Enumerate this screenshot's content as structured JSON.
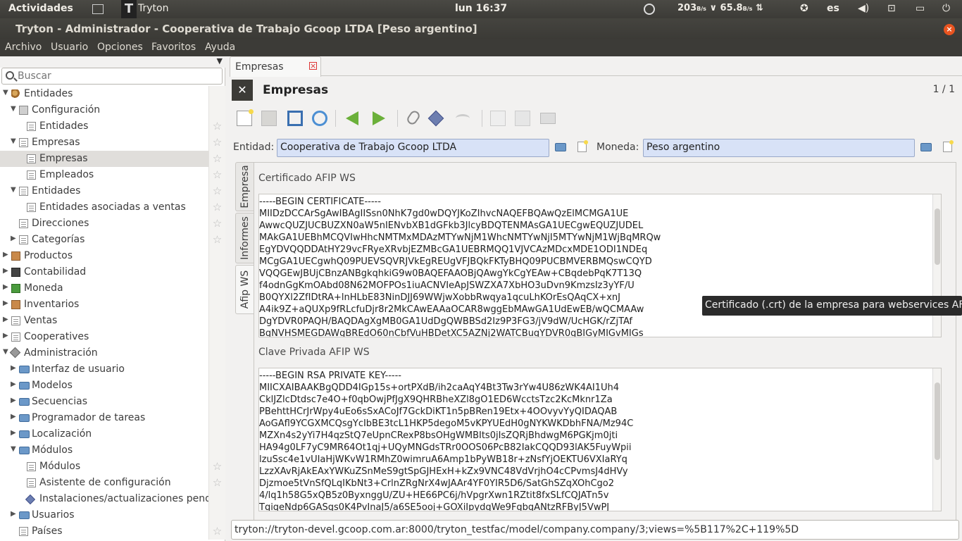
{
  "top_panel": {
    "activities": "Actividades",
    "app_name": "Tryton",
    "clock": "lun 16:37",
    "net_down": "203",
    "net_down_unit": "B/s",
    "net_up": "65.8",
    "net_up_unit": "B/s",
    "lang": "es"
  },
  "window": {
    "title": "Tryton - Administrador - Cooperativa de Trabajo Gcoop LTDA [Peso argentino]",
    "close": "×"
  },
  "menubar": {
    "items": [
      "Archivo",
      "Usuario",
      "Opciones",
      "Favoritos",
      "Ayuda"
    ]
  },
  "sidebar": {
    "search_placeholder": "Buscar",
    "tree": [
      {
        "label": "Entidades",
        "level": 0,
        "expander": "▼",
        "icon": "people",
        "star": false
      },
      {
        "label": "Configuración",
        "level": 1,
        "expander": "▼",
        "icon": "config",
        "star": false
      },
      {
        "label": "Entidades",
        "level": 2,
        "expander": "",
        "icon": "doc",
        "star": true
      },
      {
        "label": "Empresas",
        "level": 1,
        "expander": "▼",
        "icon": "doc",
        "star": true
      },
      {
        "label": "Empresas",
        "level": 2,
        "expander": "",
        "icon": "doc",
        "star": true,
        "selected": true
      },
      {
        "label": "Empleados",
        "level": 2,
        "expander": "",
        "icon": "doc",
        "star": true
      },
      {
        "label": "Entidades",
        "level": 1,
        "expander": "▼",
        "icon": "doc",
        "star": true
      },
      {
        "label": "Entidades asociadas a ventas",
        "level": 2,
        "expander": "",
        "icon": "doc",
        "star": true
      },
      {
        "label": "Direcciones",
        "level": 1,
        "expander": "",
        "icon": "doc",
        "star": true
      },
      {
        "label": "Categorías",
        "level": 1,
        "expander": "▶",
        "icon": "doc",
        "star": true
      },
      {
        "label": "Productos",
        "level": 0,
        "expander": "▶",
        "icon": "box",
        "star": false
      },
      {
        "label": "Contabilidad",
        "level": 0,
        "expander": "▶",
        "icon": "calc",
        "star": false
      },
      {
        "label": "Moneda",
        "level": 0,
        "expander": "▶",
        "icon": "money",
        "star": false
      },
      {
        "label": "Inventarios",
        "level": 0,
        "expander": "▶",
        "icon": "box",
        "star": false
      },
      {
        "label": "Ventas",
        "level": 0,
        "expander": "▶",
        "icon": "doc",
        "star": false
      },
      {
        "label": "Cooperatives",
        "level": 0,
        "expander": "▶",
        "icon": "doc",
        "star": false
      },
      {
        "label": "Administración",
        "level": 0,
        "expander": "▼",
        "icon": "tools",
        "star": false
      },
      {
        "label": "Interfaz de usuario",
        "level": 1,
        "expander": "▶",
        "icon": "folder",
        "star": false
      },
      {
        "label": "Modelos",
        "level": 1,
        "expander": "▶",
        "icon": "folder",
        "star": false
      },
      {
        "label": "Secuencias",
        "level": 1,
        "expander": "▶",
        "icon": "folder",
        "star": false
      },
      {
        "label": "Programador de tareas",
        "level": 1,
        "expander": "▶",
        "icon": "folder",
        "star": false
      },
      {
        "label": "Localización",
        "level": 1,
        "expander": "▶",
        "icon": "folder",
        "star": false
      },
      {
        "label": "Módulos",
        "level": 1,
        "expander": "▼",
        "icon": "folder",
        "star": false
      },
      {
        "label": "Módulos",
        "level": 2,
        "expander": "",
        "icon": "doc",
        "star": true
      },
      {
        "label": "Asistente de configuración",
        "level": 2,
        "expander": "",
        "icon": "doc",
        "star": true
      },
      {
        "label": "Instalaciones/actualizaciones pendientes",
        "level": 2,
        "expander": "",
        "icon": "diamond",
        "star": false
      },
      {
        "label": "Usuarios",
        "level": 1,
        "expander": "▶",
        "icon": "folder",
        "star": false
      },
      {
        "label": "Países",
        "level": 1,
        "expander": "",
        "icon": "doc",
        "star": true
      }
    ]
  },
  "main": {
    "tab_label": "Empresas",
    "form_title": "Empresas",
    "record_count": "1 / 1",
    "entity_label": "Entidad:",
    "entity_value": "Cooperativa de Trabajo Gcoop LTDA",
    "currency_label": "Moneda:",
    "currency_value": "Peso argentino",
    "vtabs": [
      "Empresa",
      "Informes",
      "Afip WS"
    ],
    "cert_label": "Certificado AFIP WS",
    "cert_lines": [
      "-----BEGIN CERTIFICATE-----",
      "MIIDzDCCArSgAwIBAgIISsn0NhK7gd0wDQYJKoZIhvcNAQEFBQAwQzElMCMGA1UE",
      "AwwcQUZJUCBUZXN0aW5nIENvbXB1dGFkb3JlcyBDQTENMAsGA1UECgwEQUZJUDEL",
      "MAkGA1UEBhMCQVIwHhcNMTMxMDAzMTYwNjM1WhcNMTYwNjI5MTYwNjM1WjBqMRQw",
      "EgYDVQQDDAtHY29vcFRyeXRvbjEZMBcGA1UEBRMQQ1VJVCAzMDcxMDE1ODI1NDEq",
      "MCgGA1UECgwhQ09PUEVSQVRJVkEgREUgVFJBQkFKTyBHQ09PUCBMVERBMQswCQYD",
      "VQQGEwJBUjCBnzANBgkqhkiG9w0BAQEFAAOBjQAwgYkCgYEAw+CBqdebPqK7T13Q",
      "f4odnGgKmOAbd08N62MOFPOs1iuACNVIeApJSWZXA7XbHO3uDvn9KmzsIz3yYF/U",
      "B0QYXl2ZfIDtRA+lnHLbE83NinDJJ69WWjwXobbRwqya1qcuLhKOrEsQAqCX+xnJ",
      "A4ik9Z+aQUXp9fRLcfuDjr8r2MkCAwEAAaOCAR8wggEbMAwGA1UdEwEB/wQCMAAw",
      "DgYDVR0PAQH/BAQDAgXgMB0GA1UdDgQWBBSd2Iz9P3FG3/jV9dW/UcHGK/rZjTAf",
      "BgNVHSMEGDAWgBREdO60nCbfVuHBDetXC5AZNj2WATCBugYDVR0gBIGyMIGvMIGs"
    ],
    "key_label": "Clave Privada AFIP WS",
    "key_lines": [
      "-----BEGIN RSA PRIVATE KEY-----",
      "MIICXAIBAAKBgQDD4IGp15s+ortPXdB/ih2caAqY4Bt3Tw3rYw4U86zWK4AI1Uh4",
      "CklJZlcDtdsc7e4O+f0qbOwjPfJgX9QHRBheXZl8gO1ED6WcctsTzc2KcMknr1Za",
      "PBehttHCrJrWpy4uEo6sSxACoJf7GckDiKT1n5pBRen19Etx+4OOvyvYyQIDAQAB",
      "AoGAfl9YCGXMCQsgYcIbBE3tcL1HKP5degoM5vKPYUEdH0gNYKWKDbhFNA/Mz94C",
      "MZXn4s2yYi7H4qzStQ7eUpnCRexP8bsOHgWMBIts0jIsZQRjBhdwgM6PGKjm0jti",
      "HA94g0LF7yC9MR64Ot1qj+UQyMNGdsTRr0OOS06PcB82IakCQQD93lAK5FuyWpii",
      "lzuSsc4e1vUIaHjWKvW1RMhZ0wimruA6Amp1bPyWB18r+zNsfYjOEKTU6VXIaRYq",
      "LzzXAvRjAkEAxYWKuZSnMeS9gtSpGJHExH+kZx9VNC48VdVrjhO4cCPvmsJ4dHVy",
      "Djzmoe5tVnSfQLqIKbNt3+CrlnZRgNrX4wJAAr4YF0YIR5D6/SatGhSZqXOhCgo2",
      "4/lq1h58G5xQB5z0ByxnggU/ZU+HE66PC6j/hVpgrXwn1RZtit8fxSLfCQJATn5v",
      "TgiqeNdp6GASgs0K4PvInaJ5/a6SE5ooj+GOXiIpydqWe9FgbgANtzRFByJ5VwPJ"
    ],
    "tooltip": "Certificado (.crt) de la empresa para webservices AFIP",
    "url": "tryton://tryton-devel.gcoop.com.ar:8000/tryton_testfac/model/company.company/3;views=%5B117%2C+119%5D"
  }
}
